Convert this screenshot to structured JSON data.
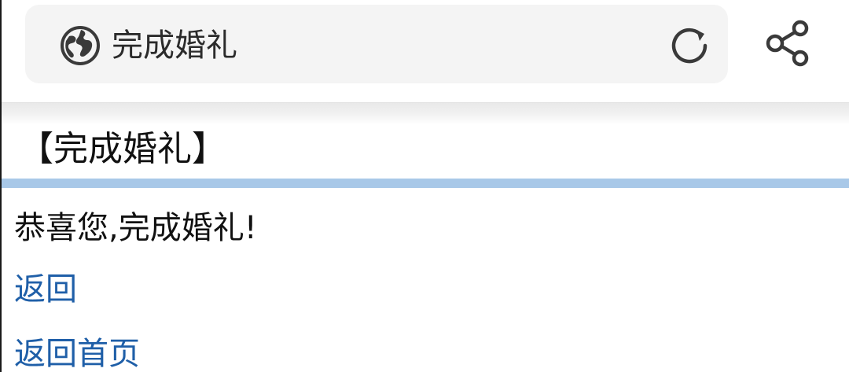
{
  "browser": {
    "url_text": "完成婚礼",
    "icons": {
      "site": "globe-icon",
      "reload": "reload-icon",
      "share": "share-icon"
    }
  },
  "page": {
    "title": "【完成婚礼】",
    "message": "恭喜您,完成婚礼!",
    "links": {
      "back": "返回",
      "home": "返回首页"
    }
  },
  "colors": {
    "link": "#1f5fa8",
    "title_rule": "#a8c8e8",
    "urlbar_bg": "#f4f4f4"
  }
}
